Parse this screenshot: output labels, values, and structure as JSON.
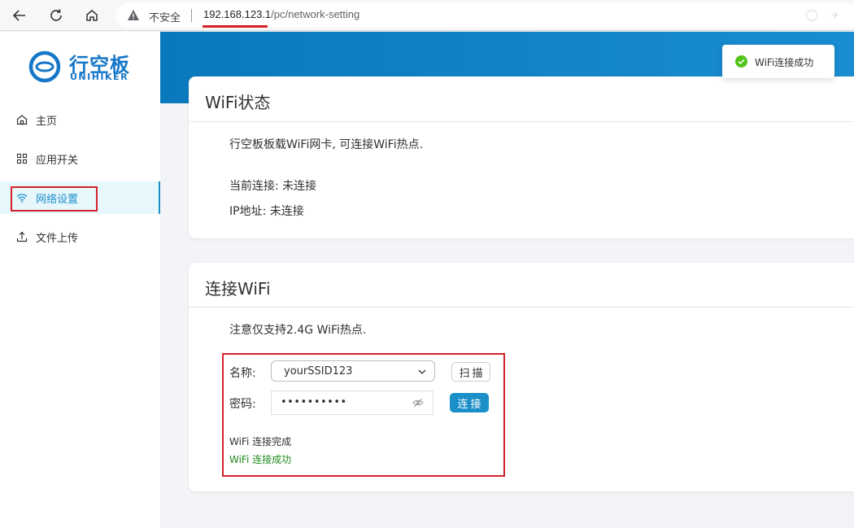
{
  "browser": {
    "insecure_label": "不安全",
    "url_host": "192.168.123.1",
    "url_path": "/pc/network-setting"
  },
  "logo": {
    "cn": "行空板",
    "en": "UNIHIKER"
  },
  "sidebar": {
    "items": [
      {
        "label": "主页",
        "icon": "home-icon"
      },
      {
        "label": "应用开关",
        "icon": "grid-icon"
      },
      {
        "label": "网络设置",
        "icon": "wifi-icon",
        "active": true
      },
      {
        "label": "文件上传",
        "icon": "upload-icon"
      }
    ]
  },
  "wifi_status": {
    "title": "WiFi状态",
    "description": "行空板板载WiFi网卡, 可连接WiFi热点.",
    "current_connection": "当前连接: 未连接",
    "ip_address": "IP地址: 未连接"
  },
  "connect_wifi": {
    "title": "连接WiFi",
    "notice": "注意仅支持2.4G WiFi热点.",
    "name_label": "名称:",
    "ssid_value": "yourSSID123",
    "password_label": "密码:",
    "password_value": "••••••••••",
    "scan_button": "扫描",
    "connect_button": "连接",
    "status_complete": "WiFi 连接完成",
    "status_success": "WiFi 连接成功"
  },
  "toast": {
    "message": "WiFi连接成功"
  },
  "colors": {
    "accent": "#1a8fc8",
    "success_text": "#1e8a1e",
    "highlight_box": "#d42128",
    "toast_ok": "#52c41a"
  }
}
